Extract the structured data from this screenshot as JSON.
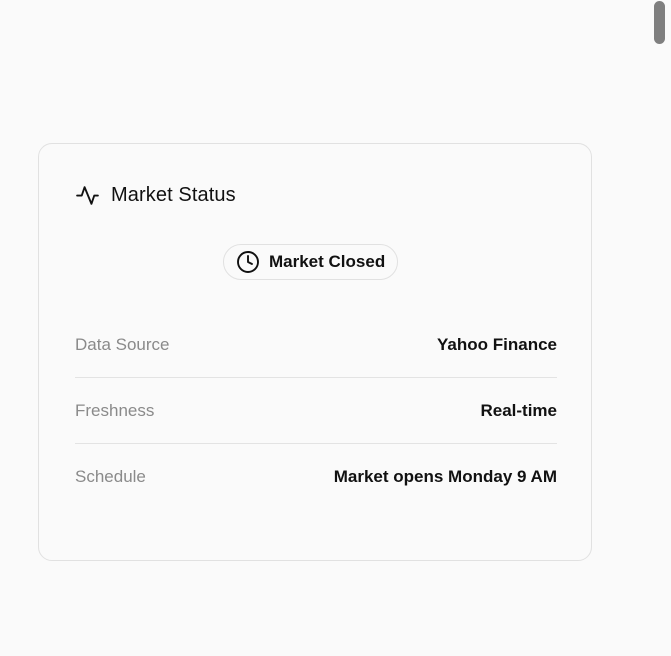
{
  "card": {
    "title": "Market Status",
    "title_icon": "activity-icon",
    "status": {
      "label": "Market Closed",
      "icon": "clock-icon"
    },
    "rows": [
      {
        "label": "Data Source",
        "value": "Yahoo Finance"
      },
      {
        "label": "Freshness",
        "value": "Real-time"
      },
      {
        "label": "Schedule",
        "value": "Market opens Monday 9 AM"
      }
    ]
  },
  "colors": {
    "background": "#fafafa",
    "border": "#e1e1e1",
    "label": "#8a8a8a",
    "text": "#111111",
    "scrollbar_thumb": "#7f7f7f"
  }
}
